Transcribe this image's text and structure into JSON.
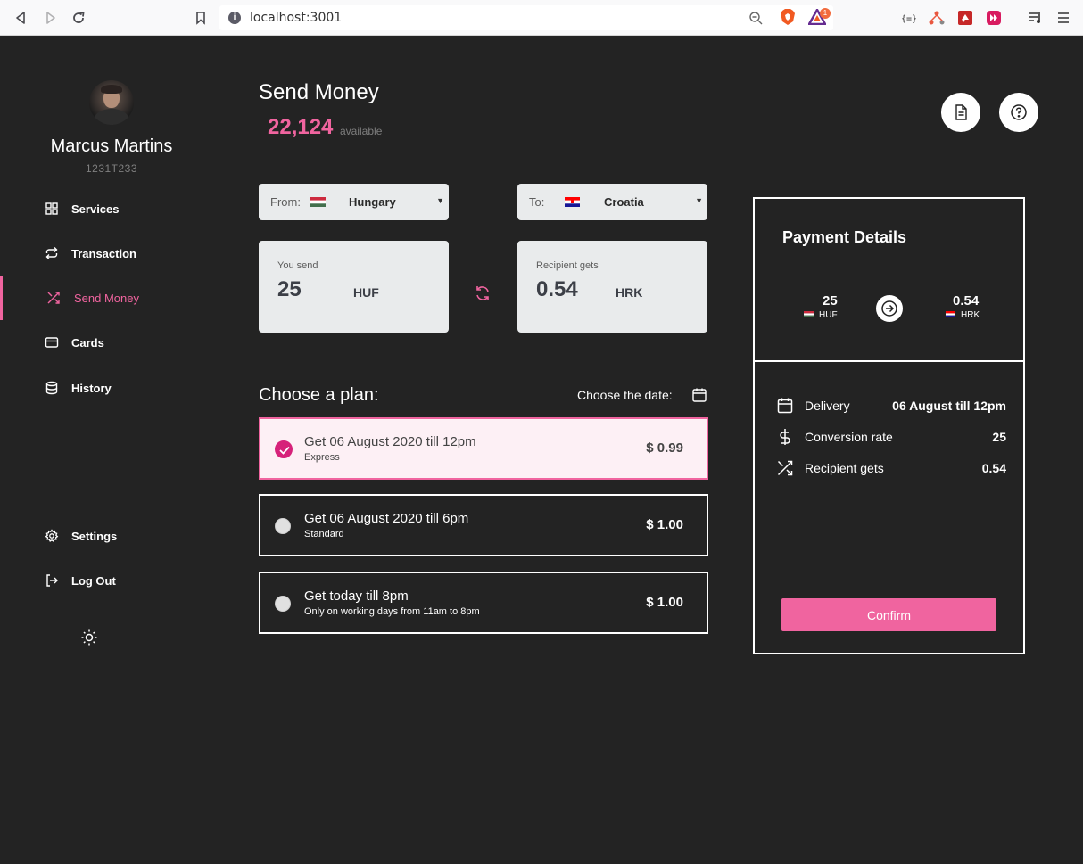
{
  "browser": {
    "url": "localhost:3001",
    "badge_count": "1"
  },
  "user": {
    "name": "Marcus Martins",
    "id": "1231T233"
  },
  "sidebar": {
    "items": [
      {
        "label": "Services",
        "icon": "grid-icon"
      },
      {
        "label": "Transaction",
        "icon": "repeat-icon"
      },
      {
        "label": "Send Money",
        "icon": "shuffle-icon",
        "active": true
      },
      {
        "label": "Cards",
        "icon": "credit-card-icon"
      },
      {
        "label": "History",
        "icon": "database-icon"
      }
    ],
    "bottom_items": [
      {
        "label": "Settings",
        "icon": "gear-icon"
      },
      {
        "label": "Log Out",
        "icon": "logout-icon"
      }
    ]
  },
  "main": {
    "title": "Send Money",
    "balance": "22,124",
    "balance_label": "available",
    "from": {
      "label": "From:",
      "country": "Hungary"
    },
    "to": {
      "label": "To:",
      "country": "Croatia"
    },
    "send": {
      "caption": "You send",
      "amount": "25",
      "currency": "HUF"
    },
    "receive": {
      "caption": "Recipient gets",
      "amount": "0.54",
      "currency": "HRK"
    },
    "plan_heading": "Choose a plan:",
    "date_label": "Choose the date:",
    "plans": [
      {
        "title": "Get 06 August 2020 till 12pm",
        "subtitle": "Express",
        "price": "$ 0.99",
        "selected": true
      },
      {
        "title": "Get 06 August 2020 till 6pm",
        "subtitle": "Standard",
        "price": "$ 1.00",
        "selected": false
      },
      {
        "title": "Get today till 8pm",
        "subtitle": "Only on working days from 11am to 8pm",
        "price": "$ 1.00",
        "selected": false
      }
    ]
  },
  "payment": {
    "title": "Payment Details",
    "from_amount": "25",
    "from_currency": "HUF",
    "to_amount": "0.54",
    "to_currency": "HRK",
    "rows": [
      {
        "label": "Delivery",
        "value": "06 August till 12pm",
        "icon": "calendar-icon"
      },
      {
        "label": "Conversion rate",
        "value": "25",
        "icon": "dollar-icon"
      },
      {
        "label": "Recipient gets",
        "value": "0.54",
        "icon": "shuffle-icon"
      }
    ],
    "confirm_label": "Confirm"
  },
  "colors": {
    "accent": "#f0649f",
    "background": "#232323",
    "selected_bg": "#fdf0f5"
  }
}
